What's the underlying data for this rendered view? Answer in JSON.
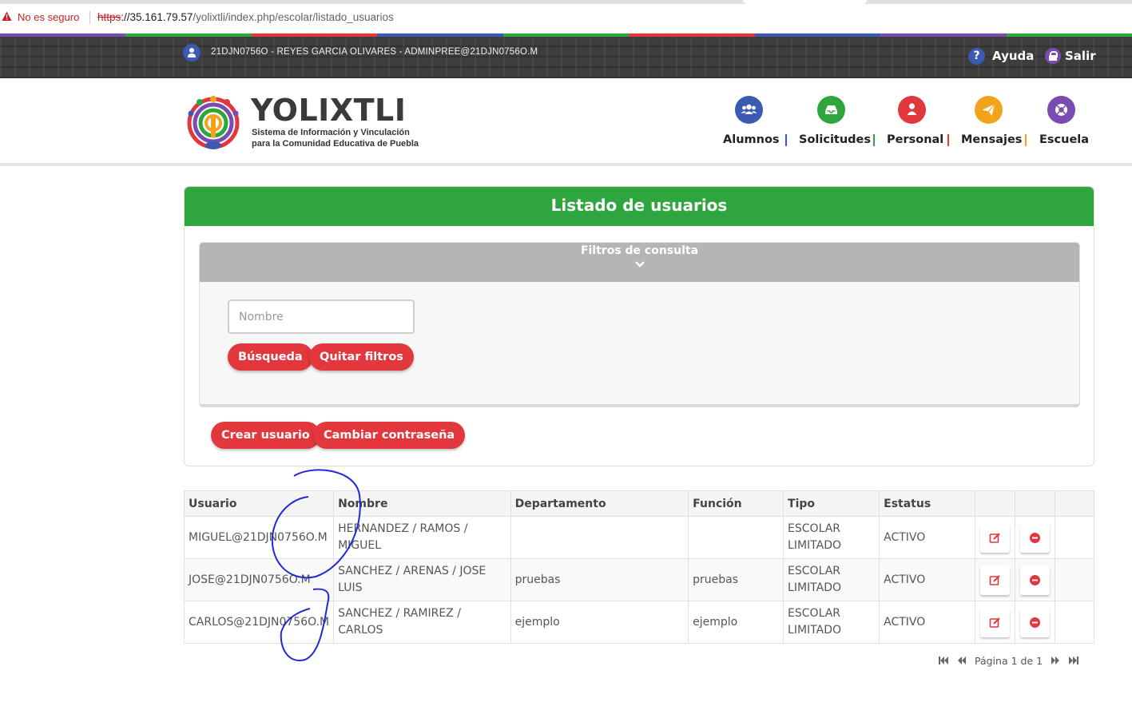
{
  "browser": {
    "security_label": "No es seguro",
    "url_scheme": "https",
    "url_host": "://35.161.79.57",
    "url_path": "/yolixtli/index.php/escolar/listado_usuarios"
  },
  "topbar": {
    "user_info": "21DJN0756O - REYES GARCIA OLIVARES - ADMINPREE@21DJN0756O.M",
    "help_label": "Ayuda",
    "exit_label": "Salir"
  },
  "brand": {
    "title": "YOLIXTLI",
    "subtitle_line1": "Sistema de Información y Vinculación",
    "subtitle_line2": "para la Comunidad Educativa de Puebla"
  },
  "nav": [
    {
      "label": "Alumnos",
      "icon": "users-icon",
      "color": "#3a5bb0"
    },
    {
      "label": "Solicitudes",
      "icon": "inbox-icon",
      "color": "#2ea63d"
    },
    {
      "label": "Personal",
      "icon": "person-icon",
      "color": "#e3373e"
    },
    {
      "label": "Mensajes",
      "icon": "paper-plane-icon",
      "color": "#f2a31b"
    },
    {
      "label": "Escuela",
      "icon": "lifering-icon",
      "color": "#7a4bb0"
    }
  ],
  "panel": {
    "title": "Listado de usuarios",
    "filters_title": "Filtros de consulta",
    "name_placeholder": "Nombre",
    "search_button": "Búsqueda",
    "clear_button": "Quitar filtros",
    "create_button": "Crear usuario",
    "change_password_button": "Cambiar contraseña"
  },
  "table": {
    "headers": [
      "Usuario",
      "Nombre",
      "Departamento",
      "Función",
      "Tipo",
      "Estatus"
    ],
    "rows": [
      {
        "usuario": "MIGUEL@21DJN0756O.M",
        "nombre": "HERNANDEZ / RAMOS / MIGUEL",
        "departamento": "",
        "funcion": "",
        "tipo": "ESCOLAR LIMITADO",
        "estatus": "ACTIVO"
      },
      {
        "usuario": "JOSE@21DJN0756O.M",
        "nombre": "SANCHEZ / ARENAS / JOSE LUIS",
        "departamento": "pruebas",
        "funcion": "pruebas",
        "tipo": "ESCOLAR LIMITADO",
        "estatus": "ACTIVO"
      },
      {
        "usuario": "CARLOS@21DJN0756O.M",
        "nombre": "SANCHEZ / RAMIREZ / CARLOS",
        "departamento": "ejemplo",
        "funcion": "ejemplo",
        "tipo": "ESCOLAR LIMITADO",
        "estatus": "ACTIVO"
      }
    ]
  },
  "pager": {
    "label": "Página 1 de 1"
  },
  "colors": {
    "accent_green": "#2ea63d",
    "accent_red": "#e3373e",
    "filter_gray": "#b5b5b5"
  }
}
